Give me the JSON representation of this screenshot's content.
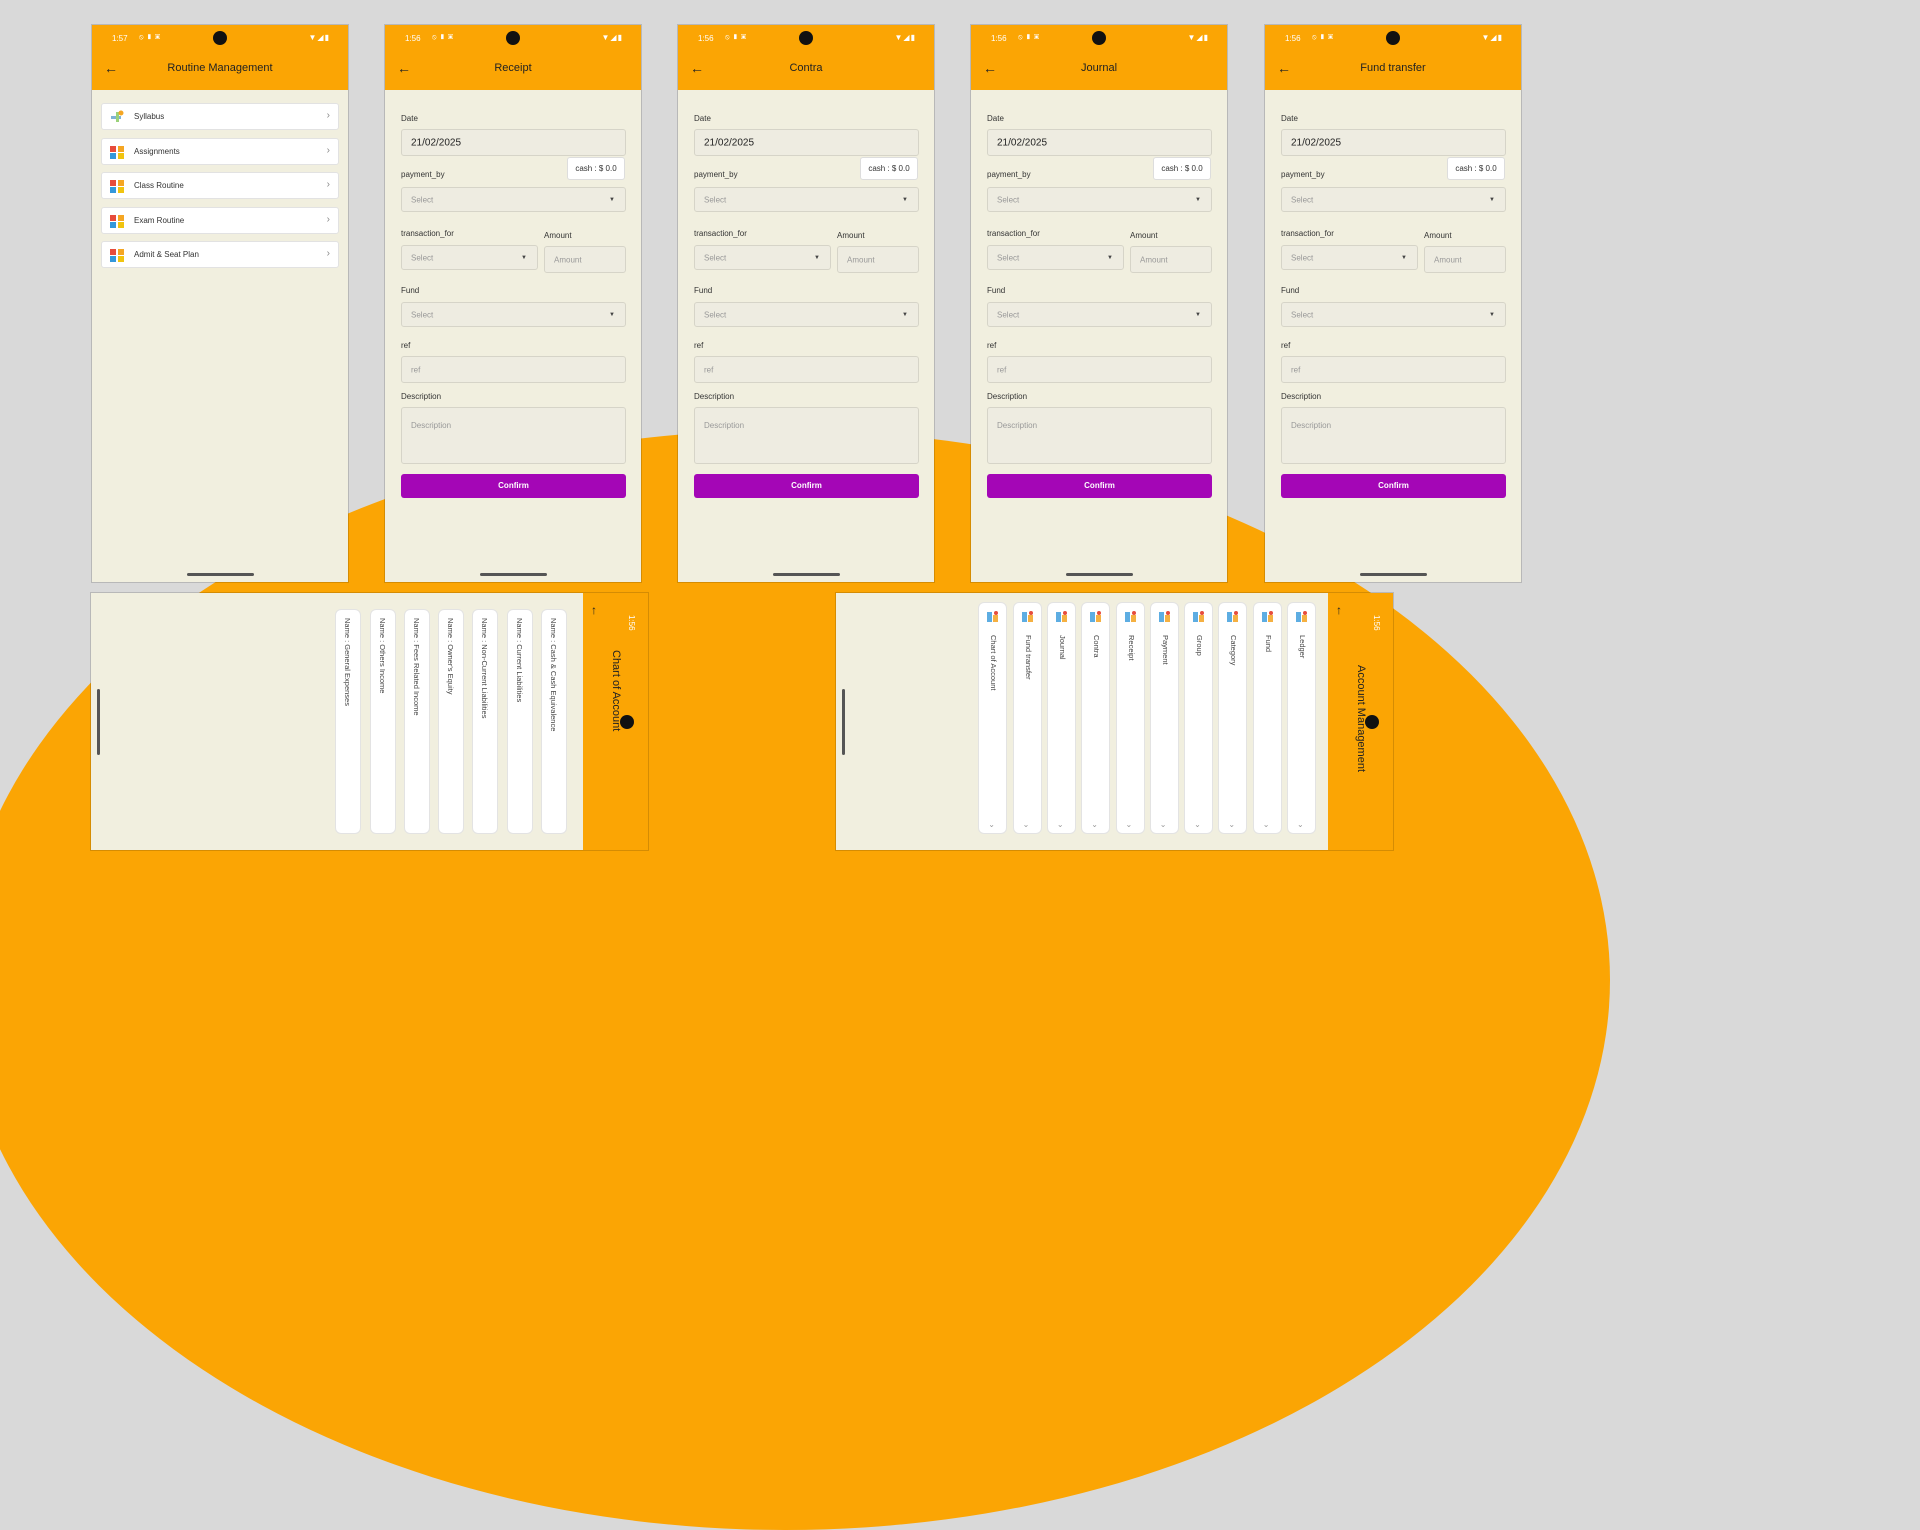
{
  "colors": {
    "accent": "#fba504",
    "confirm": "#a406b6",
    "surface": "#f1efdf"
  },
  "status_time_1": "1:57",
  "status_time": "1:56",
  "routine": {
    "title": "Routine Management",
    "items": [
      {
        "label": "Syllabus",
        "icon": "syllabus-icon"
      },
      {
        "label": "Assignments",
        "icon": "assignment-icon"
      },
      {
        "label": "Class Routine",
        "icon": "routine-icon"
      },
      {
        "label": "Exam Routine",
        "icon": "routine-icon"
      },
      {
        "label": "Admit & Seat Plan",
        "icon": "routine-icon"
      }
    ]
  },
  "form": {
    "date_label": "Date",
    "date_value": "21/02/2025",
    "cash": "cash : $ 0.0",
    "payment_by_label": "payment_by",
    "select_placeholder": "Select",
    "transaction_for_label": "transaction_for",
    "amount_label": "Amount",
    "amount_placeholder": "Amount",
    "fund_label": "Fund",
    "ref_label": "ref",
    "ref_placeholder": "ref",
    "description_label": "Description",
    "description_placeholder": "Description",
    "confirm": "Confirm"
  },
  "screens": [
    {
      "title": "Receipt"
    },
    {
      "title": "Contra"
    },
    {
      "title": "Journal"
    },
    {
      "title": "Fund transfer"
    }
  ],
  "chart_of_account": {
    "title": "Chart of Account",
    "items": [
      "Name : Cash & Cash Equivalence",
      "Name : Current Liabilities",
      "Name : Non-Current Liabilities",
      "Name : Owner's Equity",
      "Name : Fees Related Income",
      "Name : Others Income",
      "Name : General Expenses"
    ]
  },
  "account_management": {
    "title": "Account Management",
    "items": [
      "Ledger",
      "Fund",
      "Category",
      "Group",
      "Payment",
      "Receipt",
      "Contra",
      "Journal",
      "Fund transfer",
      "Chart of Account"
    ]
  }
}
